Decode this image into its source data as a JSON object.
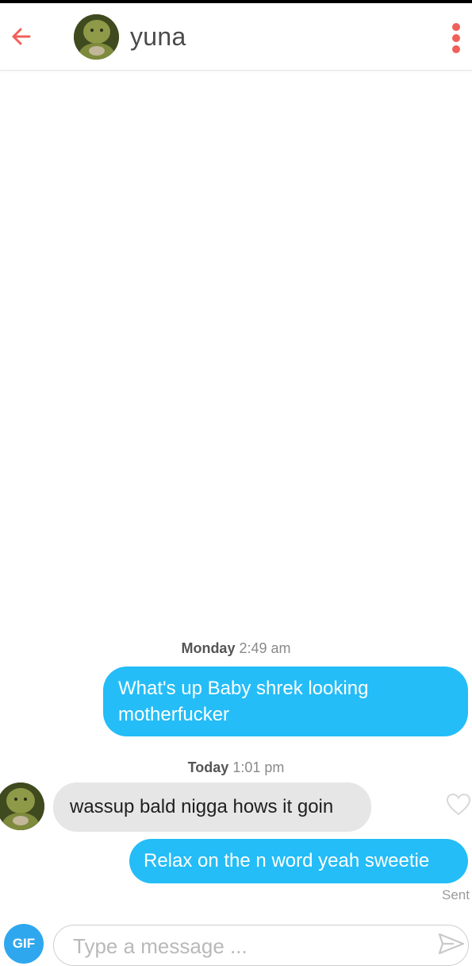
{
  "header": {
    "title": "yuna",
    "accent": "#f0605a"
  },
  "conversation": {
    "timestamps": [
      {
        "day": "Monday",
        "time": "2:49 am"
      },
      {
        "day": "Today",
        "time": "1:01 pm"
      }
    ],
    "messages": [
      {
        "direction": "outgoing",
        "text": "What's up Baby shrek looking motherfucker"
      },
      {
        "direction": "incoming",
        "text": "wassup bald nigga hows it goin"
      },
      {
        "direction": "outgoing",
        "text": "Relax on the n word yeah sweetie"
      }
    ],
    "status": "Sent",
    "outgoing_color": "#24bdf7",
    "incoming_color": "#e6e6e6"
  },
  "composer": {
    "gif_label": "GIF",
    "placeholder": "Type a message ..."
  }
}
